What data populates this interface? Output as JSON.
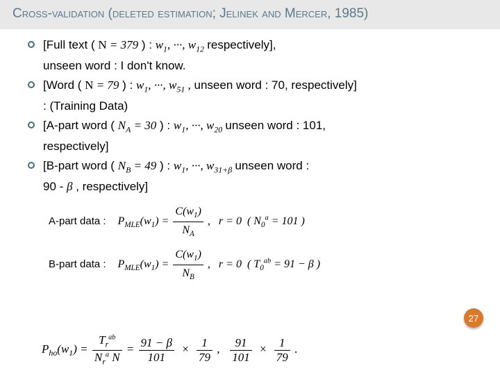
{
  "title": "Cross-validation (deleted estimation; Jelinek and Mercer, 1985)",
  "bullets": {
    "b1_pre": "[Full text (",
    "b1_math1": " N = 379 ",
    "b1_mid1": ") :",
    "b1_math2": " w₁, ···, w₁₂ ",
    "b1_post": "respectively],",
    "b1_line2": "unseen word : I don't know.",
    "b2_pre": "[Word (",
    "b2_math1": " N = 79 ",
    "b2_mid": ") :",
    "b2_math2": " w₁, ···, w₅₁ ,",
    "b2_post": " unseen word : 70, respectively]",
    "b2_line2": ": (Training Data)",
    "b3_pre": "[A-part word (",
    "b3_math1": " N_A = 30 ",
    "b3_mid": ") :",
    "b3_math2": " w₁, ···, w₂₀ ",
    "b3_post": "unseen word : 101,",
    "b3_line2": "respectively]",
    "b4_pre": "[B-part word (",
    "b4_math1": " N_B = 49 ",
    "b4_mid": ") :",
    "b4_math2": " w₁, ···, w₃₁+β ",
    "b4_post": "unseen word :",
    "b4_line2a": "90 - ",
    "b4_line2b": "β",
    "b4_line2c": ", respectively]"
  },
  "formulas": {
    "a_label": "A-part data :",
    "a_eq": "P_MLE(w₁) = C(w₁)/N_A ,  r = 0 ( N₀^a = 101 )",
    "b_label": "B-part data :",
    "b_eq": "P_MLE(w₁) = C(w₁)/N_B ,  r = 0 ( T₀^ab = 91 − β )"
  },
  "bottom_eq": "P_ho(w₁) = T_r^ab / (N_r^a · N) = (91−β)/(101) × 1/79 ≈ 91/101 × 1/79 .",
  "page": "27"
}
